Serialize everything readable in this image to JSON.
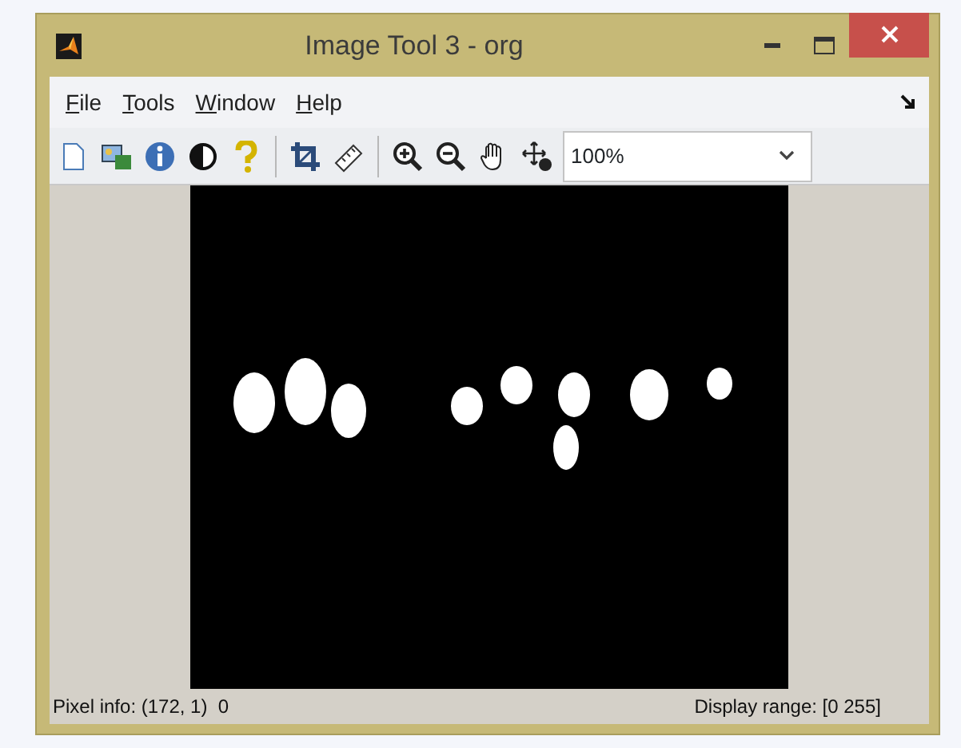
{
  "window": {
    "title": "Image Tool 3 - org"
  },
  "menu": [
    {
      "label": "File"
    },
    {
      "label": "Tools"
    },
    {
      "label": "Window"
    },
    {
      "label": "Help"
    }
  ],
  "toolbar": {
    "zoom": "100%"
  },
  "status_bar": {
    "pixel_info": "Pixel info: (172, 1)  0",
    "display_range": "Display range: [0 255]"
  }
}
